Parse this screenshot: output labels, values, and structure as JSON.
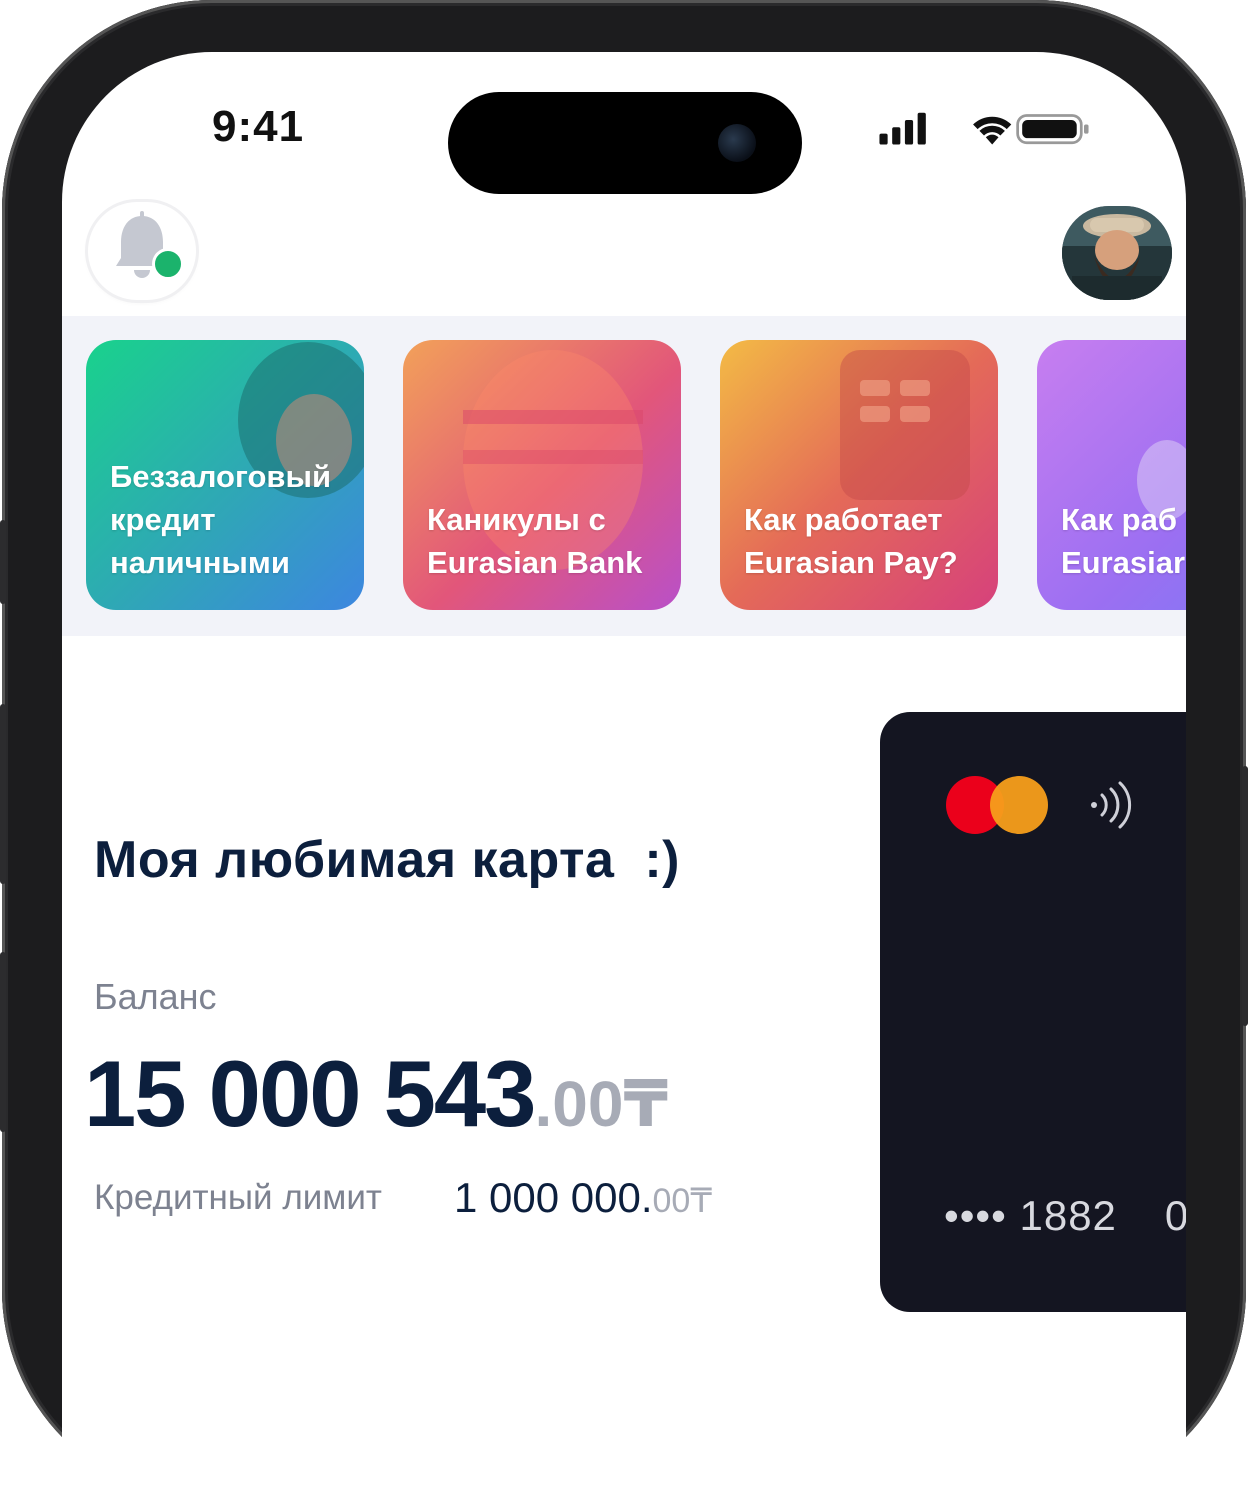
{
  "status_bar": {
    "time": "9:41"
  },
  "stories": [
    {
      "title": "Беззалоговый\nкредит\nналичными",
      "gradient": [
        "#1fcf8e",
        "#3aa8c7",
        "#4b6fd9"
      ]
    },
    {
      "title": "Каникулы с\nEurasian Bank",
      "gradient": [
        "#f0a05a",
        "#e0577a",
        "#b84ec4"
      ]
    },
    {
      "title": "Как работает\nEurasian Pay?",
      "gradient": [
        "#f4b84a",
        "#e4685a",
        "#d9407a"
      ]
    },
    {
      "title": "Как раб\nEurasiar",
      "gradient": [
        "#c77df0",
        "#9a6ef2",
        "#7a78f5"
      ]
    }
  ],
  "card_section": {
    "title": "Моя любимая карта  :)",
    "balance_label": "Баланс",
    "balance_main": "15 000 543",
    "balance_fraction": ".00₸",
    "limit_label": "Кредитный лимит",
    "limit_main": "1 000 000.",
    "limit_fraction": "00₸"
  },
  "bank_card": {
    "brand": "mastercard",
    "masked_number": "•••• 1882",
    "trailing_fragment": "0",
    "color": "#141521"
  },
  "colors": {
    "primary_text": "#0c1f3d",
    "secondary_text": "#7d8290",
    "notification_dot": "#1bb36c",
    "stories_background": "#f2f3f9"
  }
}
